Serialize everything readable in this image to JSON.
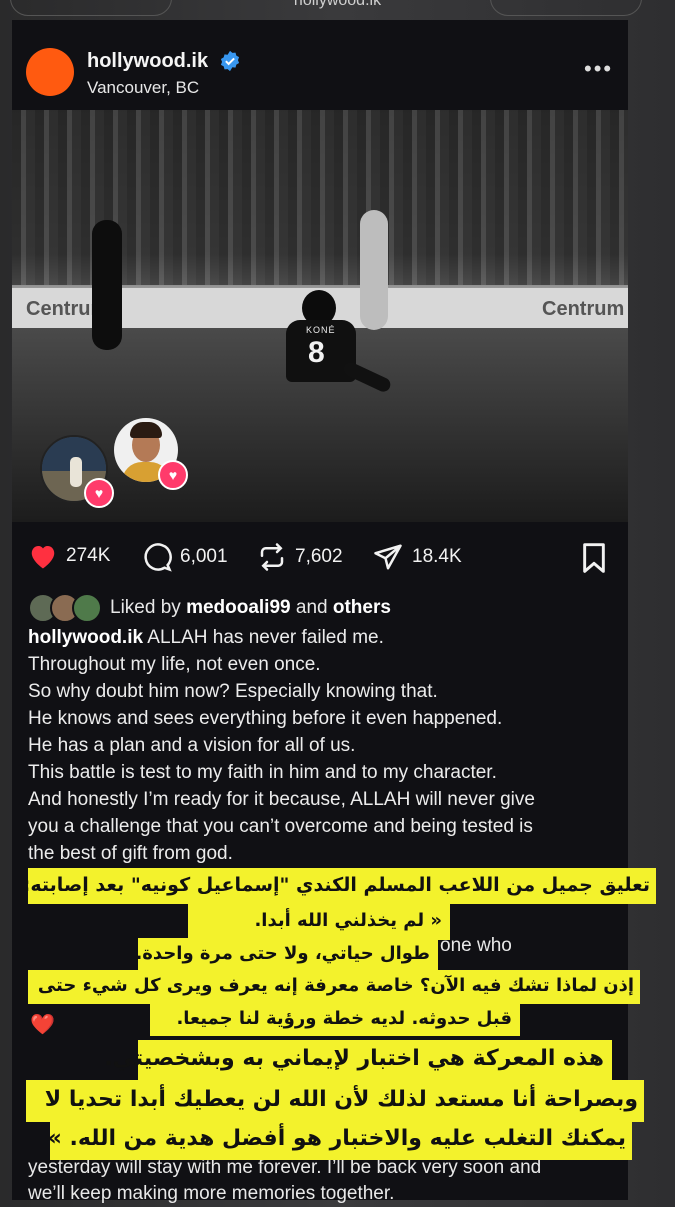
{
  "browser": {
    "url": "hollywood.ik"
  },
  "post": {
    "username": "hollywood.ik",
    "location": "Vancouver, BC",
    "photo": {
      "jersey_name": "KONÉ",
      "jersey_number": "8",
      "board_left": "Centrum",
      "board_right": "Centrum"
    },
    "stats": {
      "likes": "274K",
      "comments": "6,001",
      "reposts": "7,602",
      "shares": "18.4K"
    },
    "liked_by": {
      "prefix": "Liked by",
      "user": "medooali99",
      "and": "and",
      "others": "others"
    },
    "caption_user": "hollywood.ik",
    "caption_lines": [
      "ALLAH has never failed me.",
      "Throughout my life, not even once.",
      "So why doubt him now? Especially knowing that.",
      "He knows and sees everything before it even happened.",
      "He has a plan and a vision for all of us.",
      "This battle is test to my faith in him and to my character.",
      "And honestly I’m ready for it because, ALLAH will never give",
      "you a challenge that you can’t overcome and being tested is",
      "the best of gift from god."
    ],
    "hidden_fragment": "one who",
    "bottom_lines": [
      "yesterday will stay with me forever. I’ll be back very soon and",
      "we’ll keep making more memories together."
    ]
  },
  "overlay": {
    "lines": [
      "تعليق جميل من اللاعب المسلم الكندي \"إسماعيل كونيه\" بعد إصابته:",
      "« لم يخذلني الله أبدا.",
      "طوال حياتي، ولا حتى مرة واحدة.",
      "إذن لماذا تشك فيه الآن؟ خاصة معرفة إنه يعرف ويرى كل شيء حتى",
      "قبل حدوثه. لديه خطة ورؤية لنا جميعا.",
      "هذه المعركة هي اختبار لإيماني به وبشخصيتي.",
      "وبصراحة أنا مستعد لذلك لأن الله لن يعطيك أبدا تحديا لا",
      "يمكنك التغلب عليه والاختبار هو أفضل هدية من الله. »"
    ],
    "highlight_color": "#f3f22c"
  },
  "colors": {
    "avatar": "#ff5a10",
    "verified": "#3897f0",
    "heart": "#ff3040",
    "story_heart": "#ff3b6b",
    "card_bg": "#101014"
  },
  "icons": [
    "verified-badge-icon",
    "more-options-icon",
    "heart-icon",
    "comment-icon",
    "repost-icon",
    "share-icon",
    "save-bookmark-icon",
    "red-heart-icon"
  ]
}
